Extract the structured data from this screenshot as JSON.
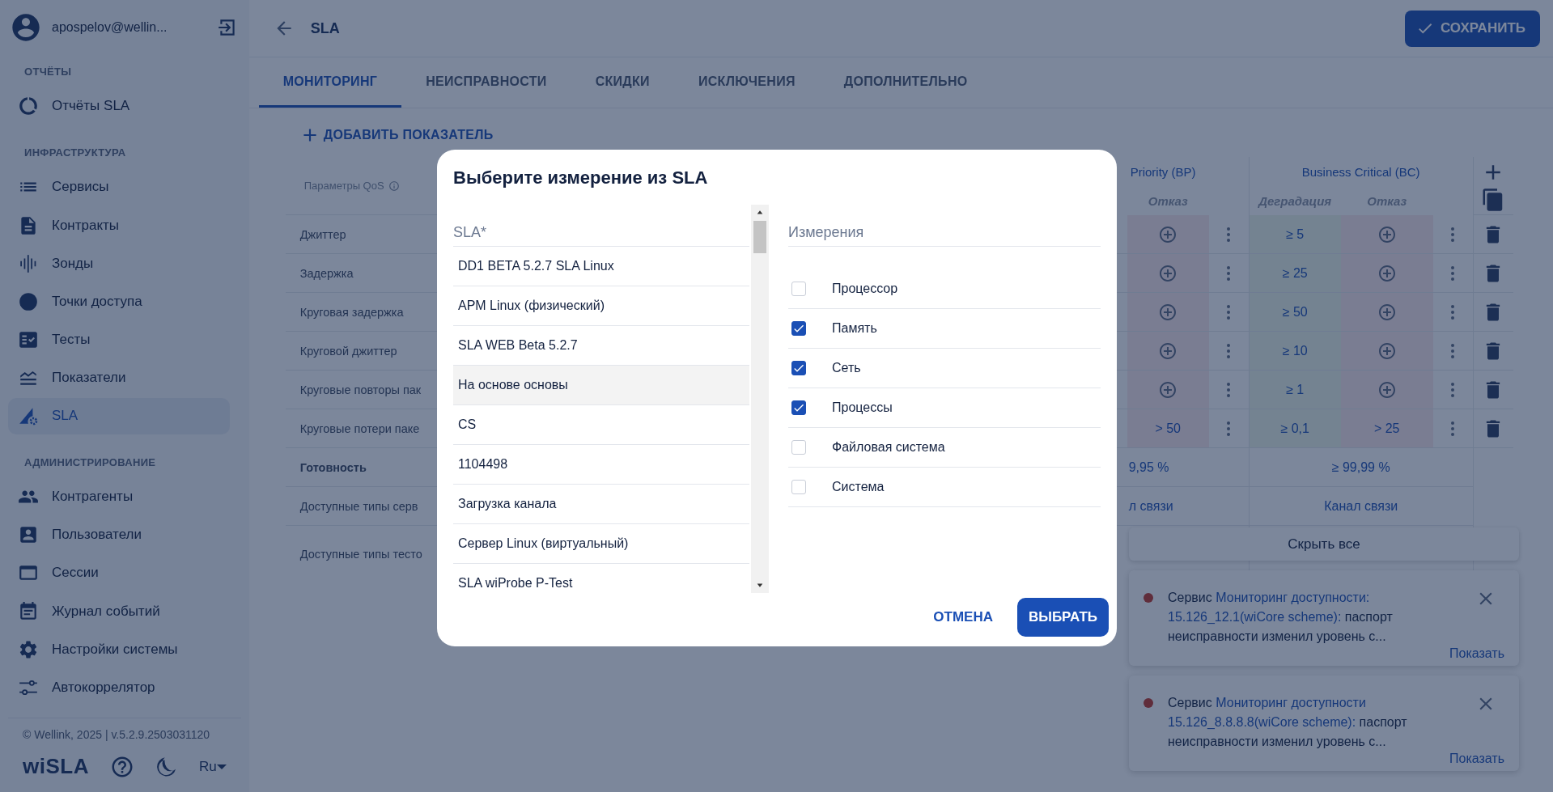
{
  "sidebar": {
    "user": "apospelov@wellin...",
    "sections": [
      {
        "title": "ОТЧЁТЫ",
        "items": [
          {
            "label": "Отчёты SLA",
            "selected": false
          }
        ]
      },
      {
        "title": "ИНФРАСТРУКТУРА",
        "items": [
          {
            "label": "Сервисы",
            "selected": false
          },
          {
            "label": "Контракты",
            "selected": false
          },
          {
            "label": "Зонды",
            "selected": false
          },
          {
            "label": "Точки доступа",
            "selected": false
          },
          {
            "label": "Тесты",
            "selected": false
          },
          {
            "label": "Показатели",
            "selected": false
          },
          {
            "label": "SLA",
            "selected": true
          }
        ]
      },
      {
        "title": "АДМИНИСТРИРОВАНИЕ",
        "items": [
          {
            "label": "Контрагенты",
            "selected": false
          },
          {
            "label": "Пользователи",
            "selected": false
          },
          {
            "label": "Сессии",
            "selected": false
          },
          {
            "label": "Журнал событий",
            "selected": false
          },
          {
            "label": "Настройки системы",
            "selected": false
          },
          {
            "label": "Автокоррелятор",
            "selected": false
          }
        ]
      }
    ],
    "copyright": "© Wellink, 2025 | v.5.2.9.2503031120",
    "logo": "wiSLA",
    "language": "Ru"
  },
  "header": {
    "title": "SLA",
    "save_button": "СОХРАНИТЬ"
  },
  "tabs": [
    {
      "label": "МОНИТОРИНГ",
      "selected": true
    },
    {
      "label": "НЕИСПРАВНОСТИ",
      "selected": false
    },
    {
      "label": "СКИДКИ",
      "selected": false
    },
    {
      "label": "ИСКЛЮЧЕНИЯ",
      "selected": false
    },
    {
      "label": "ДОПОЛНИТЕЛЬНО",
      "selected": false
    }
  ],
  "add_indicator": "ДОБАВИТЬ ПОКАЗАТЕЛЬ",
  "qos_table": {
    "title": "Параметры QoS",
    "group_1": "Priority (BP)",
    "group_1_columns": [
      "Отказ"
    ],
    "group_2": "Business Critical (BC)",
    "group_2_columns": [
      "Деградация",
      "Отказ"
    ],
    "rows": [
      {
        "label": "Джиттер",
        "cells": [
          {
            "kind": "add"
          },
          {
            "kind": "value",
            "text": "≥ 5"
          },
          {
            "kind": "add"
          }
        ]
      },
      {
        "label": "Задержка",
        "cells": [
          {
            "kind": "add"
          },
          {
            "kind": "value",
            "text": "≥ 25"
          },
          {
            "kind": "add"
          }
        ]
      },
      {
        "label": "Круговая задержка",
        "cells": [
          {
            "kind": "add"
          },
          {
            "kind": "value",
            "text": "≥ 50"
          },
          {
            "kind": "add"
          }
        ]
      },
      {
        "label": "Круговой джиттер",
        "cells": [
          {
            "kind": "add"
          },
          {
            "kind": "value",
            "text": "≥ 10"
          },
          {
            "kind": "add"
          }
        ]
      },
      {
        "label": "Круговые повторы пак",
        "cells": [
          {
            "kind": "add"
          },
          {
            "kind": "value",
            "text": "≥ 1"
          },
          {
            "kind": "add"
          }
        ]
      },
      {
        "label": "Круговые потери паке",
        "cells": [
          {
            "kind": "value",
            "text": "> 50"
          },
          {
            "kind": "value",
            "text": "≥ 0,1"
          },
          {
            "kind": "value",
            "text": "> 25"
          }
        ]
      }
    ],
    "summary_rows": [
      {
        "kind": "total",
        "label": "Готовность",
        "values": [
          "9,95 %",
          "≥ 99,99 %"
        ]
      },
      {
        "kind": "info",
        "label": "Доступные типы серв",
        "values": [
          "л связи",
          "Канал связи"
        ]
      },
      {
        "kind": "info",
        "label": "Доступные типы тесто",
        "values": []
      }
    ]
  },
  "dialog": {
    "title": "Выберите измерение из SLA",
    "sla_list": {
      "label": "SLA*",
      "items": [
        {
          "label": "DD1 BETA 5.2.7 SLA Linux",
          "selected": false
        },
        {
          "label": "APM Linux (физический)",
          "selected": false
        },
        {
          "label": "SLA WEB Beta 5.2.7",
          "selected": false
        },
        {
          "label": "На основе основы",
          "selected": true
        },
        {
          "label": "CS",
          "selected": false
        },
        {
          "label": "1104498",
          "selected": false
        },
        {
          "label": "Загрузка канала",
          "selected": false
        },
        {
          "label": "Сервер Linux (виртуальный)",
          "selected": false
        },
        {
          "label": "SLA wiProbe P-Test",
          "selected": false
        }
      ]
    },
    "measurements": {
      "label": "Измерения",
      "items": [
        {
          "label": "Процессор",
          "checked": false
        },
        {
          "label": "Память",
          "checked": true
        },
        {
          "label": "Сеть",
          "checked": true
        },
        {
          "label": "Процессы",
          "checked": true
        },
        {
          "label": "Файловая система",
          "checked": false
        },
        {
          "label": "Система",
          "checked": false
        }
      ]
    },
    "cancel": "ОТМЕНА",
    "confirm": "ВЫБРАТЬ"
  },
  "notifications": {
    "hide_all": "Скрыть все",
    "items": [
      {
        "prefix": "Сервис",
        "link": [
          "Мониторинг доступности:",
          "15.126_12.1(wiCore scheme):"
        ],
        "text": "паспорт неисправности изменил уровень с...",
        "action": "Показать"
      },
      {
        "prefix": "Сервис",
        "link": [
          "Мониторинг доступности",
          "15.126_8.8.8.8(wiCore scheme):"
        ],
        "text": "паспорт неисправности изменил уровень с...",
        "action": "Показать"
      }
    ]
  }
}
